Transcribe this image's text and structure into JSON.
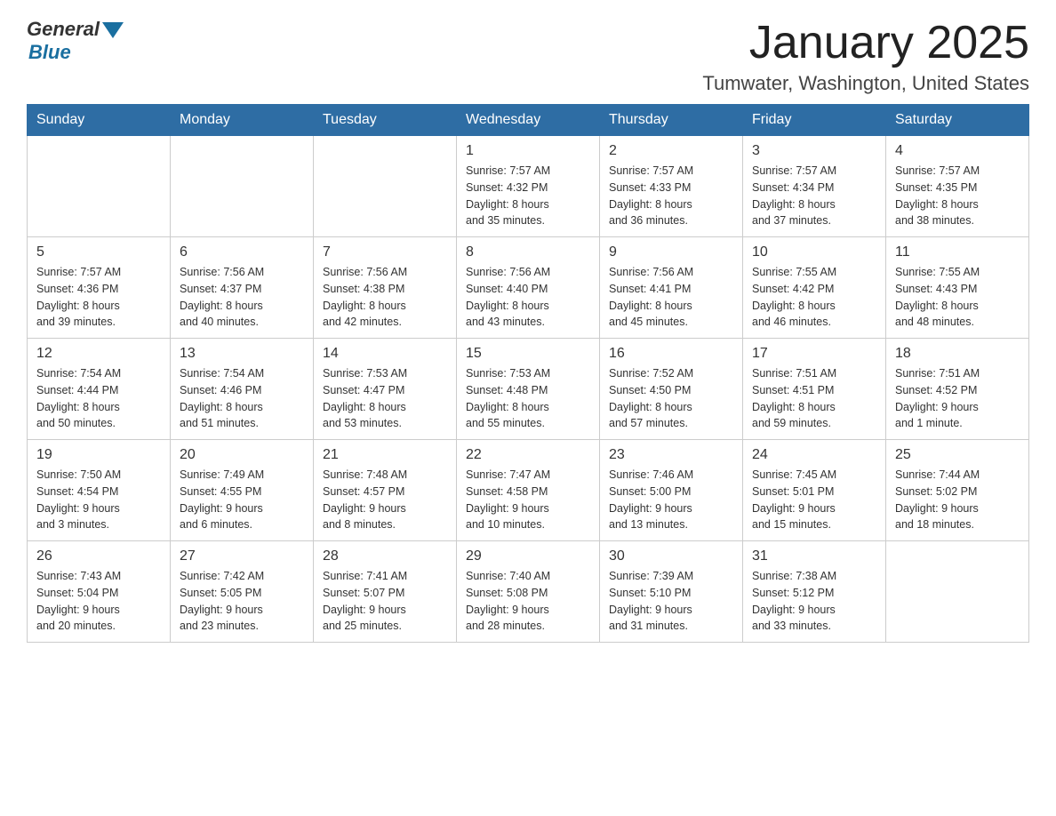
{
  "header": {
    "logo_general": "General",
    "logo_blue": "Blue",
    "title": "January 2025",
    "subtitle": "Tumwater, Washington, United States"
  },
  "days_of_week": [
    "Sunday",
    "Monday",
    "Tuesday",
    "Wednesday",
    "Thursday",
    "Friday",
    "Saturday"
  ],
  "weeks": [
    [
      {
        "day": "",
        "info": ""
      },
      {
        "day": "",
        "info": ""
      },
      {
        "day": "",
        "info": ""
      },
      {
        "day": "1",
        "info": "Sunrise: 7:57 AM\nSunset: 4:32 PM\nDaylight: 8 hours\nand 35 minutes."
      },
      {
        "day": "2",
        "info": "Sunrise: 7:57 AM\nSunset: 4:33 PM\nDaylight: 8 hours\nand 36 minutes."
      },
      {
        "day": "3",
        "info": "Sunrise: 7:57 AM\nSunset: 4:34 PM\nDaylight: 8 hours\nand 37 minutes."
      },
      {
        "day": "4",
        "info": "Sunrise: 7:57 AM\nSunset: 4:35 PM\nDaylight: 8 hours\nand 38 minutes."
      }
    ],
    [
      {
        "day": "5",
        "info": "Sunrise: 7:57 AM\nSunset: 4:36 PM\nDaylight: 8 hours\nand 39 minutes."
      },
      {
        "day": "6",
        "info": "Sunrise: 7:56 AM\nSunset: 4:37 PM\nDaylight: 8 hours\nand 40 minutes."
      },
      {
        "day": "7",
        "info": "Sunrise: 7:56 AM\nSunset: 4:38 PM\nDaylight: 8 hours\nand 42 minutes."
      },
      {
        "day": "8",
        "info": "Sunrise: 7:56 AM\nSunset: 4:40 PM\nDaylight: 8 hours\nand 43 minutes."
      },
      {
        "day": "9",
        "info": "Sunrise: 7:56 AM\nSunset: 4:41 PM\nDaylight: 8 hours\nand 45 minutes."
      },
      {
        "day": "10",
        "info": "Sunrise: 7:55 AM\nSunset: 4:42 PM\nDaylight: 8 hours\nand 46 minutes."
      },
      {
        "day": "11",
        "info": "Sunrise: 7:55 AM\nSunset: 4:43 PM\nDaylight: 8 hours\nand 48 minutes."
      }
    ],
    [
      {
        "day": "12",
        "info": "Sunrise: 7:54 AM\nSunset: 4:44 PM\nDaylight: 8 hours\nand 50 minutes."
      },
      {
        "day": "13",
        "info": "Sunrise: 7:54 AM\nSunset: 4:46 PM\nDaylight: 8 hours\nand 51 minutes."
      },
      {
        "day": "14",
        "info": "Sunrise: 7:53 AM\nSunset: 4:47 PM\nDaylight: 8 hours\nand 53 minutes."
      },
      {
        "day": "15",
        "info": "Sunrise: 7:53 AM\nSunset: 4:48 PM\nDaylight: 8 hours\nand 55 minutes."
      },
      {
        "day": "16",
        "info": "Sunrise: 7:52 AM\nSunset: 4:50 PM\nDaylight: 8 hours\nand 57 minutes."
      },
      {
        "day": "17",
        "info": "Sunrise: 7:51 AM\nSunset: 4:51 PM\nDaylight: 8 hours\nand 59 minutes."
      },
      {
        "day": "18",
        "info": "Sunrise: 7:51 AM\nSunset: 4:52 PM\nDaylight: 9 hours\nand 1 minute."
      }
    ],
    [
      {
        "day": "19",
        "info": "Sunrise: 7:50 AM\nSunset: 4:54 PM\nDaylight: 9 hours\nand 3 minutes."
      },
      {
        "day": "20",
        "info": "Sunrise: 7:49 AM\nSunset: 4:55 PM\nDaylight: 9 hours\nand 6 minutes."
      },
      {
        "day": "21",
        "info": "Sunrise: 7:48 AM\nSunset: 4:57 PM\nDaylight: 9 hours\nand 8 minutes."
      },
      {
        "day": "22",
        "info": "Sunrise: 7:47 AM\nSunset: 4:58 PM\nDaylight: 9 hours\nand 10 minutes."
      },
      {
        "day": "23",
        "info": "Sunrise: 7:46 AM\nSunset: 5:00 PM\nDaylight: 9 hours\nand 13 minutes."
      },
      {
        "day": "24",
        "info": "Sunrise: 7:45 AM\nSunset: 5:01 PM\nDaylight: 9 hours\nand 15 minutes."
      },
      {
        "day": "25",
        "info": "Sunrise: 7:44 AM\nSunset: 5:02 PM\nDaylight: 9 hours\nand 18 minutes."
      }
    ],
    [
      {
        "day": "26",
        "info": "Sunrise: 7:43 AM\nSunset: 5:04 PM\nDaylight: 9 hours\nand 20 minutes."
      },
      {
        "day": "27",
        "info": "Sunrise: 7:42 AM\nSunset: 5:05 PM\nDaylight: 9 hours\nand 23 minutes."
      },
      {
        "day": "28",
        "info": "Sunrise: 7:41 AM\nSunset: 5:07 PM\nDaylight: 9 hours\nand 25 minutes."
      },
      {
        "day": "29",
        "info": "Sunrise: 7:40 AM\nSunset: 5:08 PM\nDaylight: 9 hours\nand 28 minutes."
      },
      {
        "day": "30",
        "info": "Sunrise: 7:39 AM\nSunset: 5:10 PM\nDaylight: 9 hours\nand 31 minutes."
      },
      {
        "day": "31",
        "info": "Sunrise: 7:38 AM\nSunset: 5:12 PM\nDaylight: 9 hours\nand 33 minutes."
      },
      {
        "day": "",
        "info": ""
      }
    ]
  ]
}
